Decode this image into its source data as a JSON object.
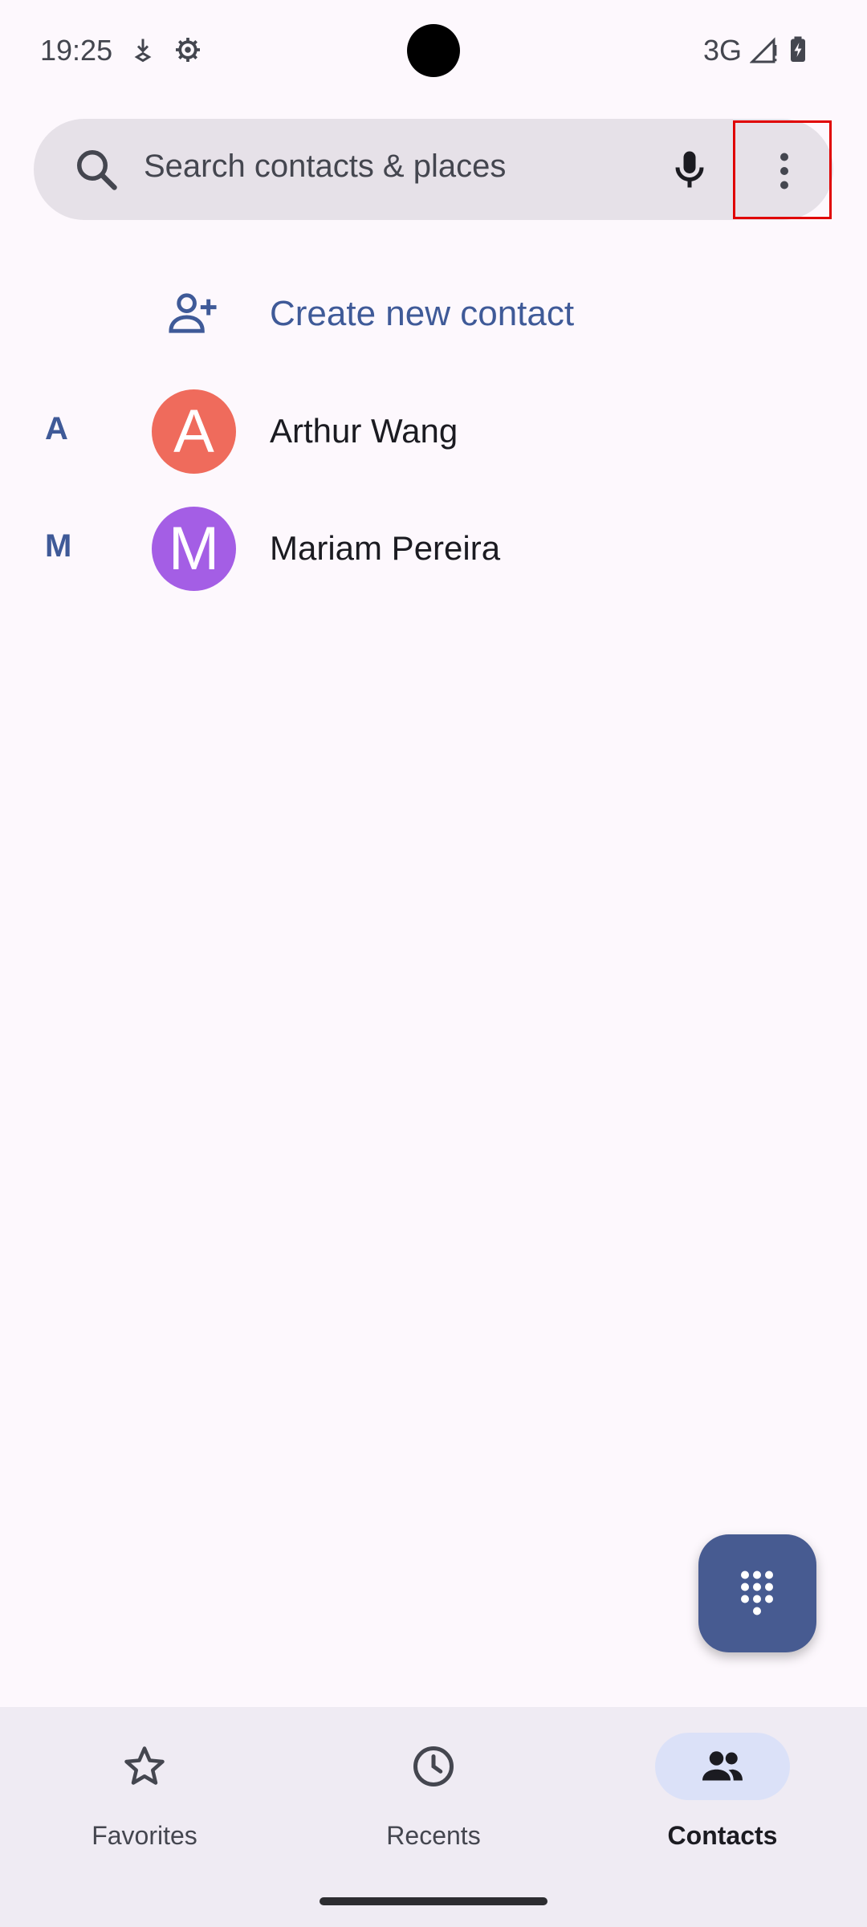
{
  "status_bar": {
    "time": "19:25",
    "network": "3G",
    "icons": [
      "download-icon",
      "settings-icon",
      "signal-icon",
      "battery-charging-icon"
    ]
  },
  "search": {
    "placeholder": "Search contacts & places",
    "icons": [
      "search-icon",
      "mic-icon",
      "more-vert-icon"
    ]
  },
  "create_contact": {
    "label": "Create new contact",
    "icon": "person-add-icon"
  },
  "contacts": [
    {
      "section": "A",
      "initial": "A",
      "name": "Arthur Wang",
      "avatar_color": "#ef6b5c"
    },
    {
      "section": "M",
      "initial": "M",
      "name": "Mariam Pereira",
      "avatar_color": "#a45ee5"
    }
  ],
  "fab": {
    "icon": "dialpad-icon"
  },
  "bottom_nav": {
    "items": [
      {
        "label": "Favorites",
        "icon": "star-outline-icon",
        "active": false
      },
      {
        "label": "Recents",
        "icon": "clock-icon",
        "active": false
      },
      {
        "label": "Contacts",
        "icon": "people-icon",
        "active": true
      }
    ]
  },
  "colors": {
    "accent": "#3f5a98",
    "fab": "#475b91",
    "background": "#fdf8fd",
    "search_bg": "#e6e1e8",
    "nav_bg": "#efebf3",
    "active_pill": "#dbe1f8",
    "highlight": "#e00000"
  }
}
